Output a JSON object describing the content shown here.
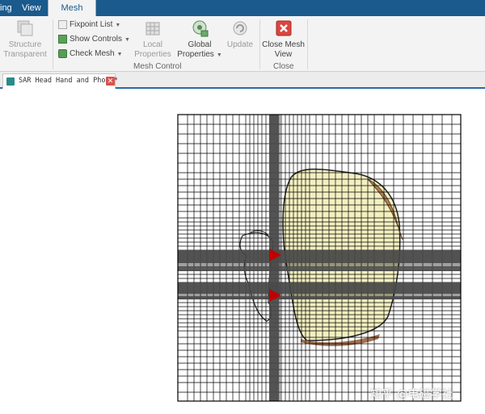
{
  "tabs": [
    {
      "label": "ing"
    },
    {
      "label": "View"
    },
    {
      "label": "Mesh"
    }
  ],
  "ribbon": {
    "structure_transparent": {
      "line1": "Structure",
      "line2": "Transparent"
    },
    "fixpoint_list": "Fixpoint List",
    "show_controls": "Show Controls",
    "check_mesh": "Check Mesh",
    "local_properties": {
      "line1": "Local",
      "line2": "Properties"
    },
    "global_properties": {
      "line1": "Global",
      "line2": "Properties"
    },
    "update": "Update",
    "close_mesh_view": {
      "line1": "Close Mesh",
      "line2": "View"
    },
    "groups": {
      "mesh_control": "Mesh Control",
      "close": "Close"
    }
  },
  "document": {
    "title": "SAR Head Hand and Phone*"
  },
  "watermark": "知乎 @电磁学社",
  "colors": {
    "tabbar": "#1a5a8c",
    "ribbon": "#f3f3f3",
    "mesh_line": "#000000",
    "dense_band": "#4a4a4a",
    "head_fill": "#f3f0c0",
    "hair": "#b08050",
    "port_marker": "#c00000"
  }
}
